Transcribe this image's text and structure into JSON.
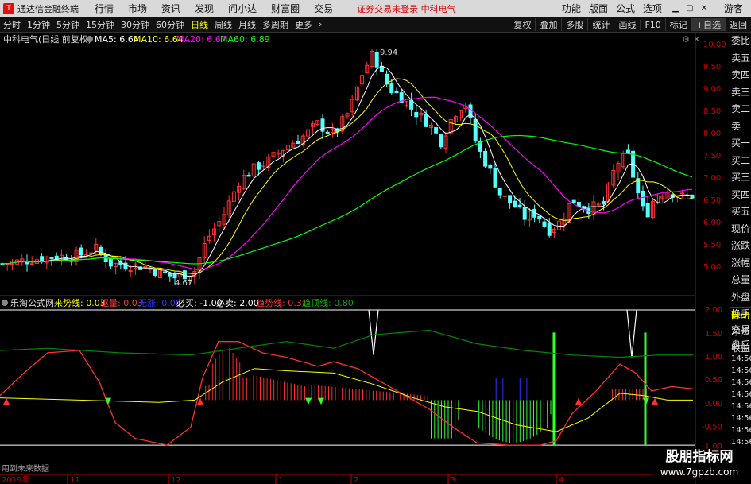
{
  "window": {
    "app_title": "通达信金融终端",
    "menu": [
      "行情",
      "市场",
      "资讯",
      "发现",
      "问小达",
      "财富圈",
      "交易"
    ],
    "notice": "证券交易未登录  中科电气",
    "right_menu": [
      "功能",
      "版面",
      "公式",
      "选项"
    ],
    "guest": "游客",
    "logo_text": "T"
  },
  "toolbar": {
    "periods": [
      "分时",
      "1分钟",
      "5分钟",
      "15分钟",
      "30分钟",
      "60分钟",
      "日线",
      "周线",
      "月线",
      "多周期",
      "更多"
    ],
    "active_period": "日线",
    "right_buttons": [
      "复权",
      "叠加",
      "多股",
      "统计",
      "画线",
      "F10",
      "标记",
      "+自选",
      "返回"
    ]
  },
  "main_chart": {
    "stock_label": "中科电气(日线 前复权)",
    "ma": [
      {
        "label": "MA5: 6.64",
        "color": "#ffffff"
      },
      {
        "label": "MA10: 6.64",
        "color": "#ffff00"
      },
      {
        "label": "MA20: 6.67",
        "color": "#ff00ff"
      },
      {
        "label": "MA60: 6.89",
        "color": "#00ff00"
      }
    ],
    "y_ticks": [
      "10.00",
      "9.50",
      "9.00",
      "8.50",
      "8.00",
      "7.50",
      "7.00",
      "6.50",
      "6.00",
      "5.50",
      "5.00"
    ],
    "high_label": "9.94",
    "low_label": "4.67"
  },
  "indicator": {
    "name": "乐淘公式网",
    "items": [
      {
        "label": "来势线: 0.03",
        "color": "#ffff00"
      },
      {
        "label": "驱量: 0.03",
        "color": "#ff3030"
      },
      {
        "label": "无涨: 0.00",
        "color": "#3030ff"
      },
      {
        "label": "必买: -1.00",
        "color": "#ffffff"
      },
      {
        "label": "必卖: 2.00",
        "color": "#ffffff"
      },
      {
        "label": "趋势线: 0.31",
        "color": "#ff3030"
      },
      {
        "label": "趋顶线: 0.80",
        "color": "#00b000"
      }
    ],
    "y_ticks": [
      "2.00",
      "1.50",
      "1.00",
      "0.50",
      "0.00",
      "-0.50",
      "-1.00"
    ],
    "footer_text": "用到未来数据"
  },
  "x_axis": {
    "labels": [
      "2019年",
      "11",
      "12",
      "1",
      "2",
      "3",
      "4"
    ]
  },
  "sidebar": {
    "items": [
      "委比",
      "卖五",
      "卖四",
      "卖三",
      "卖二",
      "卖一",
      "买一",
      "买二",
      "买三",
      "买四",
      "买五",
      "现价",
      "涨跌",
      "涨幅",
      "总量",
      "外盘",
      "换手",
      "净资",
      "收益"
    ],
    "auto_label": "自动",
    "lower_items": [
      "交易",
      "盘后",
      "14:56",
      "14:56",
      "14:56",
      "14:56",
      "14:56",
      "14:56",
      "14:56",
      "14:56"
    ]
  },
  "watermark": {
    "title": "股朋指标网",
    "url": "www.7gpzb.com"
  },
  "colors": {
    "up": "#ff3232",
    "down": "#54ffff",
    "ma5": "#ffffff",
    "ma10": "#ffff00",
    "ma20": "#ff00ff",
    "ma60": "#00ff00",
    "axis": "#c00000"
  }
}
